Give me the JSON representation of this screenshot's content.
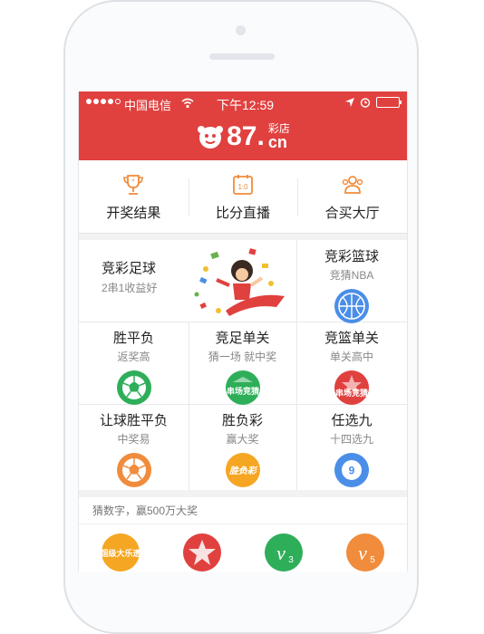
{
  "status_bar": {
    "carrier": "中国电信",
    "time": "下午12:59"
  },
  "brand": {
    "number": "87.",
    "cn_top": "彩店",
    "cn_bottom": "cn"
  },
  "tools": [
    {
      "label": "开奖结果",
      "icon": "trophy-icon"
    },
    {
      "label": "比分直播",
      "icon": "scoreboard-icon"
    },
    {
      "label": "合买大厅",
      "icon": "group-icon"
    }
  ],
  "featured": {
    "title": "竞彩足球",
    "subtitle": "2串1收益好"
  },
  "cells": [
    {
      "title": "竞彩篮球",
      "subtitle": "竞猜NBA",
      "icon": "basketball-icon"
    },
    {
      "title": "胜平负",
      "subtitle": "返奖高",
      "icon": "soccer-ball-icon"
    },
    {
      "title": "竞足单关",
      "subtitle": "猜一场 就中奖",
      "icon": "football-single-icon"
    },
    {
      "title": "竞篮单关",
      "subtitle": "单关高中",
      "icon": "basketball-single-icon"
    },
    {
      "title": "让球胜平负",
      "subtitle": "中奖易",
      "icon": "handicap-ball-icon"
    },
    {
      "title": "胜负彩",
      "subtitle": "赢大奖",
      "icon": "win-lose-icon"
    },
    {
      "title": "任选九",
      "subtitle": "十四选九",
      "icon": "pick-nine-icon"
    }
  ],
  "badges": {
    "football_single": "串场竞猜",
    "basketball_single": "串场竞猜",
    "win_lose": "胜负彩",
    "pick_nine": "9"
  },
  "note": "猜数字，赢500万大奖",
  "bottom_badges": {
    "lotto": "超级大乐透",
    "v3": "3",
    "v5": "5"
  },
  "colors": {
    "header": "#e0413f",
    "green": "#2fae5a",
    "orange": "#f08c3c",
    "blue": "#4a8ee8",
    "red": "#e0413f"
  }
}
